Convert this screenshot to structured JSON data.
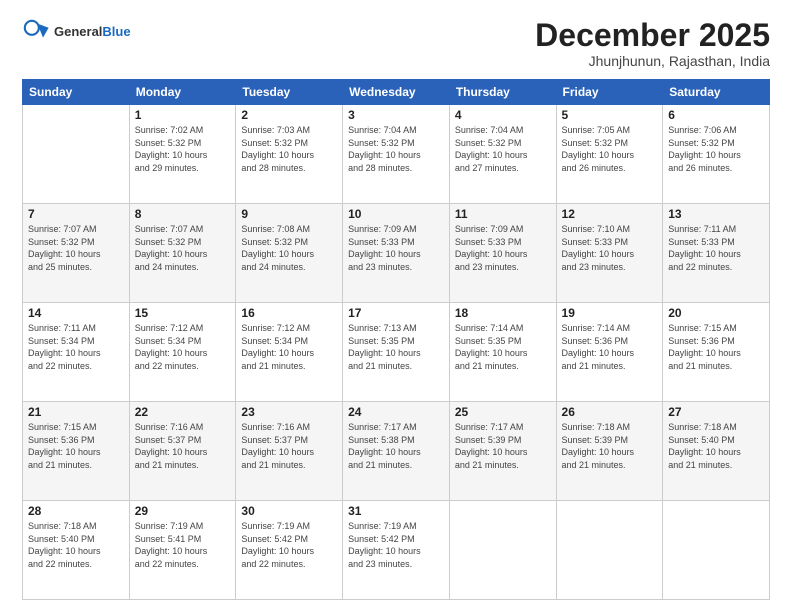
{
  "header": {
    "logo_general": "General",
    "logo_blue": "Blue",
    "title": "December 2025",
    "subtitle": "Jhunjhunun, Rajasthan, India"
  },
  "days_of_week": [
    "Sunday",
    "Monday",
    "Tuesday",
    "Wednesday",
    "Thursday",
    "Friday",
    "Saturday"
  ],
  "weeks": [
    [
      {
        "day": "",
        "info": ""
      },
      {
        "day": "1",
        "info": "Sunrise: 7:02 AM\nSunset: 5:32 PM\nDaylight: 10 hours\nand 29 minutes."
      },
      {
        "day": "2",
        "info": "Sunrise: 7:03 AM\nSunset: 5:32 PM\nDaylight: 10 hours\nand 28 minutes."
      },
      {
        "day": "3",
        "info": "Sunrise: 7:04 AM\nSunset: 5:32 PM\nDaylight: 10 hours\nand 28 minutes."
      },
      {
        "day": "4",
        "info": "Sunrise: 7:04 AM\nSunset: 5:32 PM\nDaylight: 10 hours\nand 27 minutes."
      },
      {
        "day": "5",
        "info": "Sunrise: 7:05 AM\nSunset: 5:32 PM\nDaylight: 10 hours\nand 26 minutes."
      },
      {
        "day": "6",
        "info": "Sunrise: 7:06 AM\nSunset: 5:32 PM\nDaylight: 10 hours\nand 26 minutes."
      }
    ],
    [
      {
        "day": "7",
        "info": "Sunrise: 7:07 AM\nSunset: 5:32 PM\nDaylight: 10 hours\nand 25 minutes."
      },
      {
        "day": "8",
        "info": "Sunrise: 7:07 AM\nSunset: 5:32 PM\nDaylight: 10 hours\nand 24 minutes."
      },
      {
        "day": "9",
        "info": "Sunrise: 7:08 AM\nSunset: 5:32 PM\nDaylight: 10 hours\nand 24 minutes."
      },
      {
        "day": "10",
        "info": "Sunrise: 7:09 AM\nSunset: 5:33 PM\nDaylight: 10 hours\nand 23 minutes."
      },
      {
        "day": "11",
        "info": "Sunrise: 7:09 AM\nSunset: 5:33 PM\nDaylight: 10 hours\nand 23 minutes."
      },
      {
        "day": "12",
        "info": "Sunrise: 7:10 AM\nSunset: 5:33 PM\nDaylight: 10 hours\nand 23 minutes."
      },
      {
        "day": "13",
        "info": "Sunrise: 7:11 AM\nSunset: 5:33 PM\nDaylight: 10 hours\nand 22 minutes."
      }
    ],
    [
      {
        "day": "14",
        "info": "Sunrise: 7:11 AM\nSunset: 5:34 PM\nDaylight: 10 hours\nand 22 minutes."
      },
      {
        "day": "15",
        "info": "Sunrise: 7:12 AM\nSunset: 5:34 PM\nDaylight: 10 hours\nand 22 minutes."
      },
      {
        "day": "16",
        "info": "Sunrise: 7:12 AM\nSunset: 5:34 PM\nDaylight: 10 hours\nand 21 minutes."
      },
      {
        "day": "17",
        "info": "Sunrise: 7:13 AM\nSunset: 5:35 PM\nDaylight: 10 hours\nand 21 minutes."
      },
      {
        "day": "18",
        "info": "Sunrise: 7:14 AM\nSunset: 5:35 PM\nDaylight: 10 hours\nand 21 minutes."
      },
      {
        "day": "19",
        "info": "Sunrise: 7:14 AM\nSunset: 5:36 PM\nDaylight: 10 hours\nand 21 minutes."
      },
      {
        "day": "20",
        "info": "Sunrise: 7:15 AM\nSunset: 5:36 PM\nDaylight: 10 hours\nand 21 minutes."
      }
    ],
    [
      {
        "day": "21",
        "info": "Sunrise: 7:15 AM\nSunset: 5:36 PM\nDaylight: 10 hours\nand 21 minutes."
      },
      {
        "day": "22",
        "info": "Sunrise: 7:16 AM\nSunset: 5:37 PM\nDaylight: 10 hours\nand 21 minutes."
      },
      {
        "day": "23",
        "info": "Sunrise: 7:16 AM\nSunset: 5:37 PM\nDaylight: 10 hours\nand 21 minutes."
      },
      {
        "day": "24",
        "info": "Sunrise: 7:17 AM\nSunset: 5:38 PM\nDaylight: 10 hours\nand 21 minutes."
      },
      {
        "day": "25",
        "info": "Sunrise: 7:17 AM\nSunset: 5:39 PM\nDaylight: 10 hours\nand 21 minutes."
      },
      {
        "day": "26",
        "info": "Sunrise: 7:18 AM\nSunset: 5:39 PM\nDaylight: 10 hours\nand 21 minutes."
      },
      {
        "day": "27",
        "info": "Sunrise: 7:18 AM\nSunset: 5:40 PM\nDaylight: 10 hours\nand 21 minutes."
      }
    ],
    [
      {
        "day": "28",
        "info": "Sunrise: 7:18 AM\nSunset: 5:40 PM\nDaylight: 10 hours\nand 22 minutes."
      },
      {
        "day": "29",
        "info": "Sunrise: 7:19 AM\nSunset: 5:41 PM\nDaylight: 10 hours\nand 22 minutes."
      },
      {
        "day": "30",
        "info": "Sunrise: 7:19 AM\nSunset: 5:42 PM\nDaylight: 10 hours\nand 22 minutes."
      },
      {
        "day": "31",
        "info": "Sunrise: 7:19 AM\nSunset: 5:42 PM\nDaylight: 10 hours\nand 23 minutes."
      },
      {
        "day": "",
        "info": ""
      },
      {
        "day": "",
        "info": ""
      },
      {
        "day": "",
        "info": ""
      }
    ]
  ]
}
